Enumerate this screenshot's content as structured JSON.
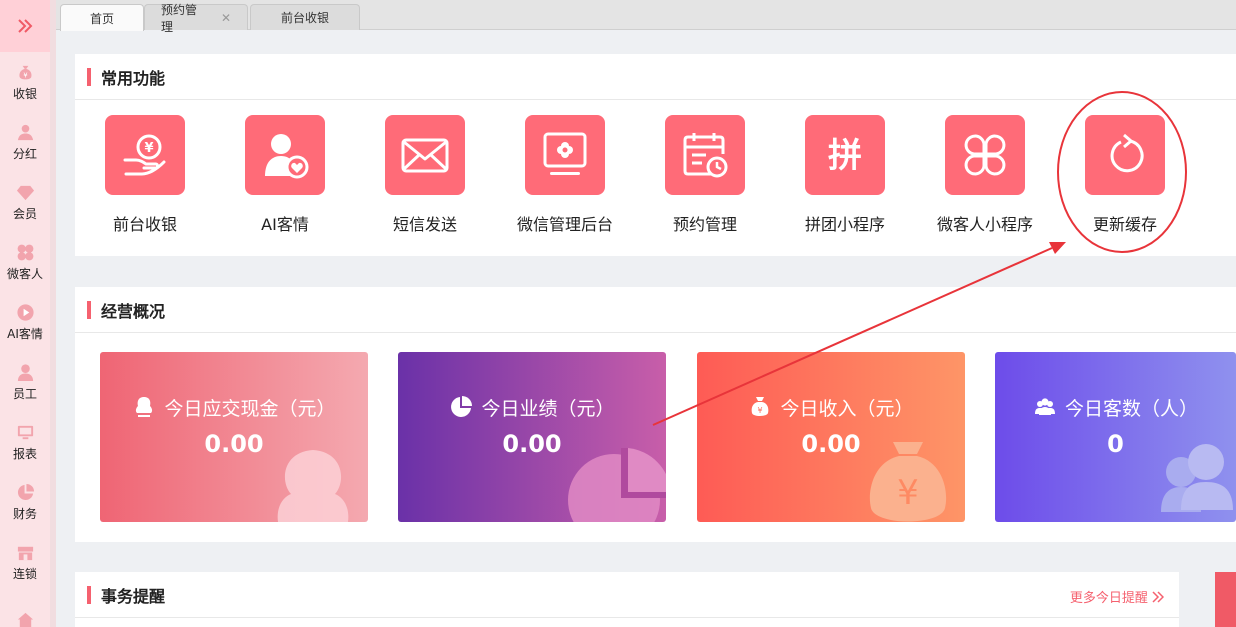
{
  "sidebar": {
    "expand_icon": "double-chevron-right-icon",
    "items": [
      {
        "label": "收银",
        "icon": "money-bag-icon"
      },
      {
        "label": "分红",
        "icon": "person-hand-icon"
      },
      {
        "label": "会员",
        "icon": "diamond-icon"
      },
      {
        "label": "微客人",
        "icon": "clover-icon"
      },
      {
        "label": "AI客情",
        "icon": "play-circle-icon"
      },
      {
        "label": "员工",
        "icon": "user-icon"
      },
      {
        "label": "报表",
        "icon": "monitor-icon"
      },
      {
        "label": "财务",
        "icon": "pie-chart-icon"
      },
      {
        "label": "连锁",
        "icon": "store-icon"
      }
    ]
  },
  "tabs": [
    {
      "label": "首页",
      "active": true
    },
    {
      "label": "预约管理",
      "closable": true
    },
    {
      "label": "前台收银"
    }
  ],
  "tab_close_glyph": "✕",
  "quick": {
    "title": "常用功能",
    "items": [
      {
        "label": "前台收银",
        "icon": "coin-hand-icon"
      },
      {
        "label": "AI客情",
        "icon": "user-heart-icon"
      },
      {
        "label": "短信发送",
        "icon": "envelope-icon"
      },
      {
        "label": "微信管理后台",
        "icon": "monitor-flower-icon"
      },
      {
        "label": "预约管理",
        "icon": "calendar-clock-icon"
      },
      {
        "label": "拼团小程序",
        "icon": "pin-char-icon",
        "glyph": "拼"
      },
      {
        "label": "微客人小程序",
        "icon": "clover-outline-icon"
      },
      {
        "label": "更新缓存",
        "icon": "refresh-icon"
      }
    ]
  },
  "overview": {
    "title": "经营概况",
    "cards": [
      {
        "title": "今日应交现金（元）",
        "value": "0.00",
        "icon": "person-icon"
      },
      {
        "title": "今日业绩（元）",
        "value": "0.00",
        "icon": "pie-chart-icon"
      },
      {
        "title": "今日收入（元）",
        "value": "0.00",
        "icon": "money-bag-icon"
      },
      {
        "title": "今日客数（人）",
        "value": "0",
        "icon": "users-icon"
      }
    ]
  },
  "reminders": {
    "title": "事务提醒",
    "more_label": "更多今日提醒",
    "more_icon": "double-chevron-right-icon"
  },
  "annotation": {
    "color": "#e8343a",
    "target": "更新缓存"
  },
  "colors": {
    "accent": "#f5616f",
    "tile": "#ff6b78",
    "sidebar_bg": "#fbe3e6"
  }
}
